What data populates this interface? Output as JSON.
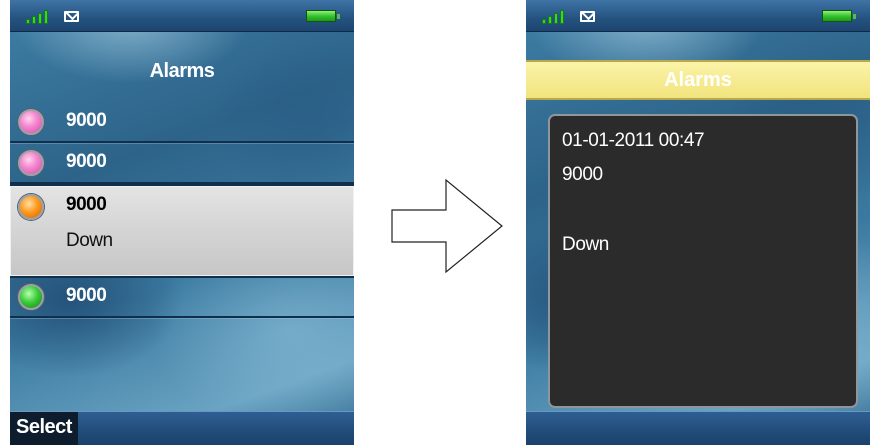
{
  "left_screen": {
    "title": "Alarms",
    "alarms": [
      {
        "number": "9000",
        "color": "pink"
      },
      {
        "number": "9000",
        "color": "pink"
      },
      {
        "number": "9000",
        "color": "orange",
        "status": "Down",
        "selected": true
      },
      {
        "number": "9000",
        "color": "green"
      }
    ],
    "softkey_left": "Select"
  },
  "right_screen": {
    "title": "Alarms",
    "details": {
      "datetime": "01-01-2011 00:47",
      "number": "9000",
      "status": "Down"
    }
  },
  "colors": {
    "status_bar": "#24527f",
    "header_yellow": "#f5ea8e",
    "detail_bg": "#2b2b2b",
    "selected_row": "#d4d4d4",
    "signal_green": "#38d33a",
    "battery_green": "#2fbf2a"
  },
  "icons": [
    "signal-icon",
    "mail-icon",
    "battery-icon",
    "alarm-status-icon",
    "arrow-right-icon"
  ]
}
